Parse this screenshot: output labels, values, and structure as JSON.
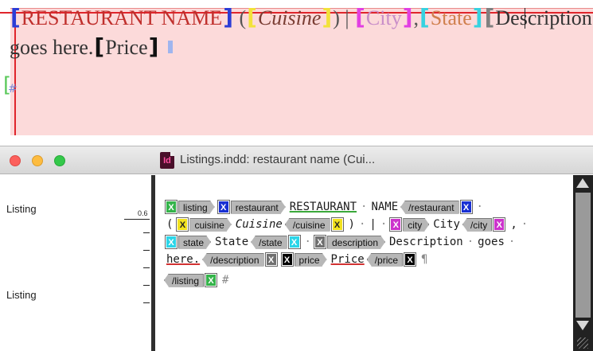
{
  "layout_view": {
    "name_text": "RESTAURANT NAME",
    "open_paren": "(",
    "cuisine_text": "Cuisine",
    "close_paren": ")",
    "separator": "|",
    "city_text": "City",
    "comma": ",",
    "state_text": "State",
    "description_line1": "Description",
    "description_line2": "goes here.",
    "price_text": "Price"
  },
  "window": {
    "title": "Listings.indd: restaurant name (Cui...",
    "app_icon_label": "Id"
  },
  "info_column": {
    "rows": [
      "Listing",
      "Listing"
    ],
    "depth_value": "0.6"
  },
  "story": {
    "x_mark": "X",
    "tags": {
      "listing_open": "listing",
      "restaurant_open": "restaurant",
      "restaurant_close": "/restaurant",
      "cuisine_open": "cuisine",
      "cuisine_close": "/cuisine",
      "city_open": "city",
      "city_close": "/city",
      "state_open": "state",
      "state_close": "/state",
      "description_open": "description",
      "description_close": "/description",
      "price_open": "price",
      "price_close": "/price",
      "listing_close": "/listing"
    },
    "text": {
      "restaurant": "RESTAURANT",
      "name": "NAME",
      "open_paren": "(",
      "cuisine": "Cuisine",
      "close_paren": ")",
      "separator": "|",
      "city": "City",
      "comma": ",",
      "state": "State",
      "description_1": "Description",
      "goes": "goes",
      "here": "here.",
      "price": "Price",
      "pilcrow": "¶",
      "hash": "#"
    }
  },
  "colors": {
    "listing": "#34b34a",
    "restaurant": "#1930d3",
    "cuisine": "#f2e21f",
    "city": "#cc33cc",
    "state": "#2bd5e8",
    "description": "#707070",
    "price": "#000000",
    "frame_fill": "#fcdada",
    "guide": "#e0252c"
  }
}
